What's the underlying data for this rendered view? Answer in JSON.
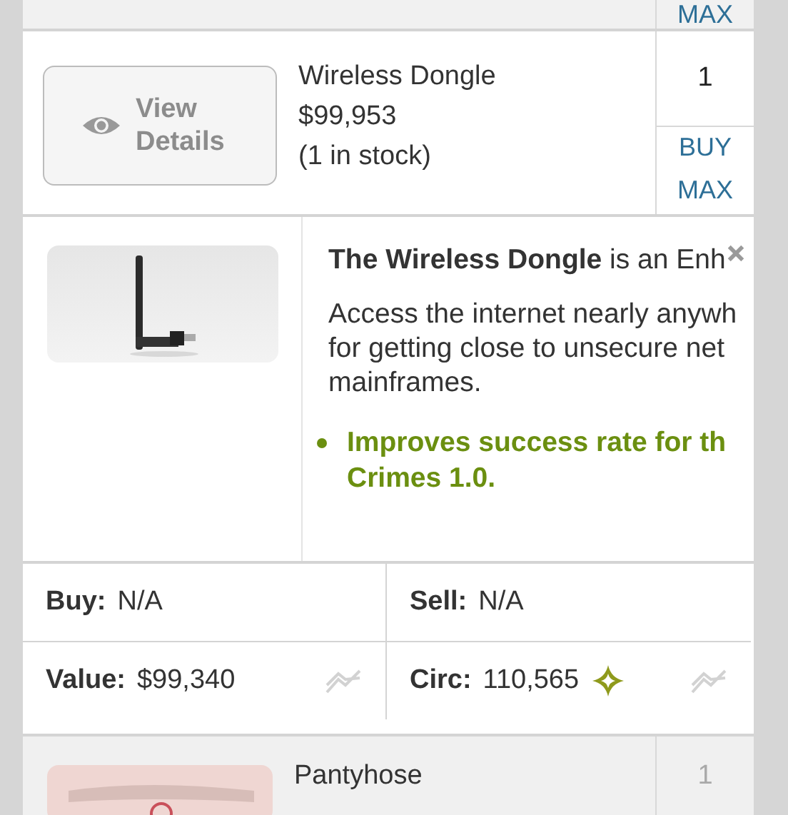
{
  "previous_row": {
    "action": "MAX"
  },
  "item": {
    "name": "Wireless Dongle",
    "price": "$99,953",
    "stock": "(1 in stock)",
    "quantity": "1",
    "view_label": "View Details",
    "actions": [
      "BUY",
      "MAX"
    ]
  },
  "details": {
    "intro": "**The Wireless Dongle** is an Enh",
    "description": [
      "Access the internet nearly anywh",
      "for getting close to unsecure net",
      "mainframes."
    ],
    "effects": [
      {
        "lines": [
          "Improves success rate for th",
          "Crimes 1.0."
        ]
      }
    ],
    "stats": [
      {
        "label": "Buy:",
        "value": "N/A",
        "kind": "plain"
      },
      {
        "label": "Sell:",
        "value": "N/A",
        "kind": "plain"
      },
      {
        "label": "Value:",
        "value": "$99,340",
        "kind": "trend"
      },
      {
        "label": "Circ:",
        "value": "110,565",
        "kind": "trend_star"
      }
    ]
  },
  "next_item": {
    "name": "Pantyhose",
    "quantity": "1",
    "disabled": true
  }
}
